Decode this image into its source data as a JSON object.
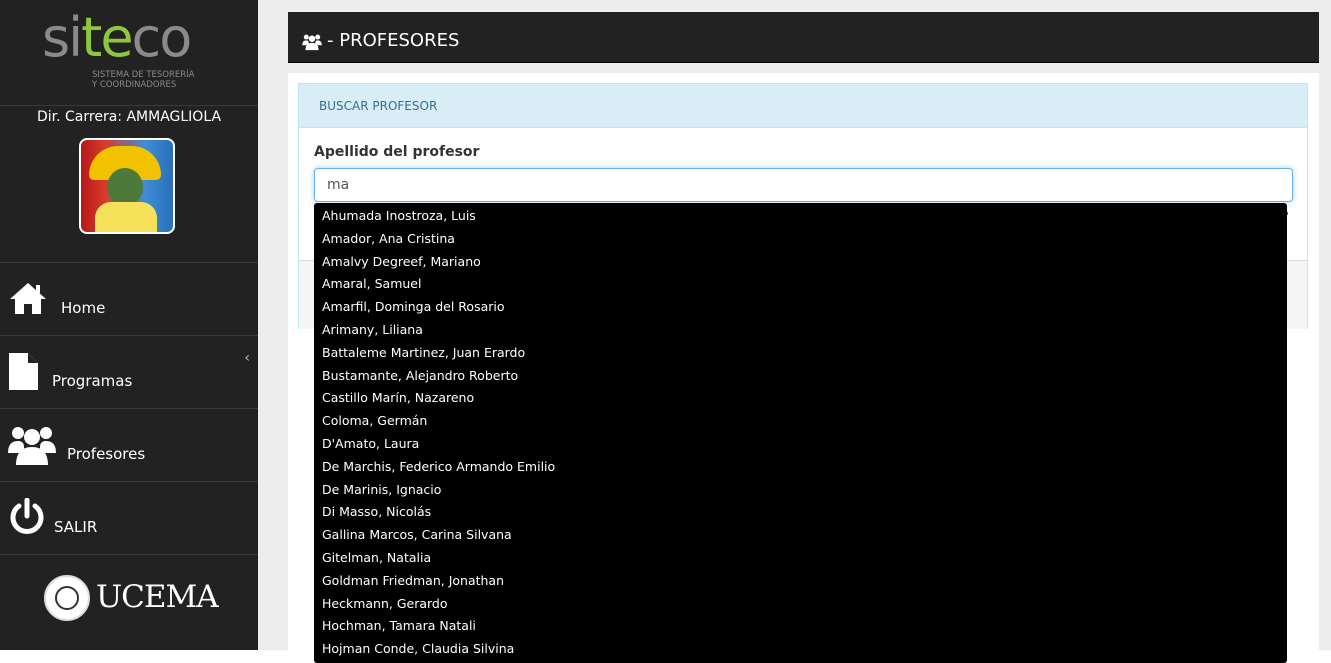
{
  "sidebar": {
    "logo": {
      "part1": "si",
      "part2": "te",
      "part3": "co",
      "subtitle_line1": "SISTEMA DE TESORERÍA",
      "subtitle_line2": "Y COORDINADORES"
    },
    "role": "Dir. Carrera: AMMAGLIOLA",
    "nav": {
      "home": "Home",
      "programas": "Programas",
      "profesores": "Profesores",
      "salir": "SALIR"
    },
    "footer_logo": "UCEMA"
  },
  "header": {
    "title": "- PROFESORES"
  },
  "panel": {
    "heading": "BUSCAR PROFESOR",
    "field_label": "Apellido del profesor",
    "input_value": "ma"
  },
  "dropdown": {
    "items": [
      "Ahumada Inostroza, Luis",
      "Amador, Ana Cristina",
      "Amalvy Degreef, Mariano",
      "Amaral, Samuel",
      "Amarfil, Dominga del Rosario",
      "Arimany, Liliana",
      "Battaleme Martinez, Juan Erardo",
      "Bustamante, Alejandro Roberto",
      "Castillo Marín, Nazareno",
      "Coloma, Germán",
      "D'Amato, Laura",
      "De Marchis, Federico Armando Emilio",
      "De Marinis, Ignacio",
      "Di Masso, Nicolás",
      "Gallina Marcos, Carina Silvana",
      "Gitelman, Natalia",
      "Goldman Friedman, Jonathan",
      "Heckmann, Gerardo",
      "Hochman, Tamara Natali",
      "Hojman Conde, Claudia Silvina"
    ]
  },
  "colors": {
    "sidebar_bg": "#222222",
    "header_bg": "#222222",
    "panel_heading_bg": "#d9edf7",
    "panel_heading_text": "#31708f",
    "logo_green": "#8ec63f",
    "dropdown_bg": "#000000"
  },
  "icons": {
    "home": "home-icon",
    "programas": "file-icon",
    "profesores": "users-icon",
    "salir": "power-icon",
    "header": "users-icon",
    "chevron": "chevron-left-icon"
  }
}
